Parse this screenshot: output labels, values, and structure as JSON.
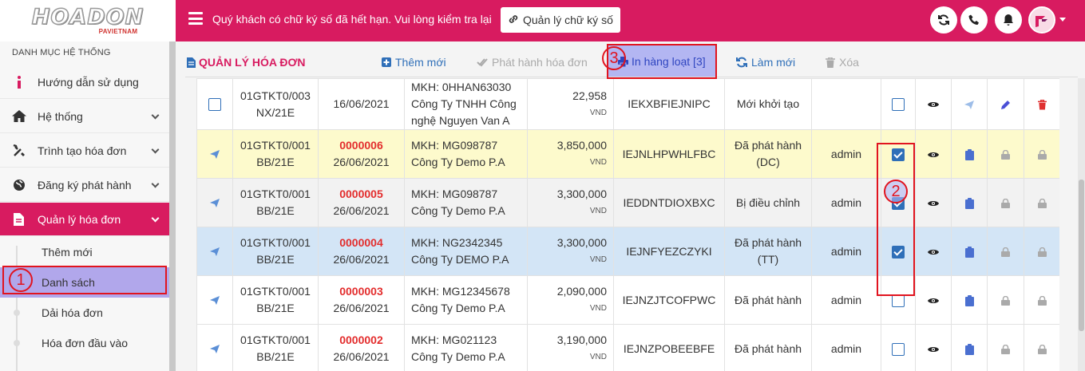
{
  "brand": {
    "logo_main": "HOADON",
    "logo_sub": "PAVIETNAM"
  },
  "header": {
    "notice": "Quý khách có chữ ký số đã hết hạn. Vui lòng kiểm tra lại",
    "sig_button": "Quản lý chữ ký số",
    "accent": "#d81b60"
  },
  "sidebar": {
    "heading": "DANH MỤC HỆ THỐNG",
    "items": [
      {
        "label": "Hướng dẫn sử dụng",
        "icon": "info-icon"
      },
      {
        "label": "Hệ thống",
        "icon": "home-icon"
      },
      {
        "label": "Trình tạo hóa đơn",
        "icon": "tools-icon"
      },
      {
        "label": "Đăng ký phát hành",
        "icon": "globe-icon"
      },
      {
        "label": "Quản lý hóa đơn",
        "icon": "document-icon"
      }
    ],
    "sub_items": [
      {
        "label": "Thêm mới"
      },
      {
        "label": "Danh sách"
      },
      {
        "label": "Dải hóa đơn"
      },
      {
        "label": "Hóa đơn đầu vào"
      }
    ]
  },
  "annotations": {
    "n1": "1",
    "n2": "2",
    "n3": "3"
  },
  "toolbar": {
    "title": "QUẢN LÝ HÓA ĐƠN",
    "add": "Thêm mới",
    "issue": "Phát hành hóa đơn",
    "print_batch": "In hàng loạt [3]",
    "refresh": "Làm mới",
    "delete": "Xóa"
  },
  "rows": [
    {
      "pattern": "01GTKT0/003",
      "series": "NX/21E",
      "number": "",
      "date": "16/06/2021",
      "cust1": "MKH: 0HHAN63030",
      "cust2": "Công Ty TNHH Công",
      "cust3": "nghệ Nguyen Van A",
      "amount": "22,958",
      "currency": "VND",
      "code": "IEKXBFIEJNIPC",
      "status1": "Mới khởi tạo",
      "status2": "",
      "user": "",
      "checked": false,
      "editable": true
    },
    {
      "pattern": "01GTKT0/001",
      "series": "BB/21E",
      "number": "0000006",
      "date": "26/06/2021",
      "cust1": "MKH: MG098787",
      "cust2": "Công Ty Demo P.A",
      "cust3": "",
      "amount": "3,850,000",
      "currency": "VND",
      "code": "IEJNLHPWHLFBC",
      "status1": "Đã phát hành",
      "status2": "(DC)",
      "user": "admin",
      "checked": true,
      "editable": false
    },
    {
      "pattern": "01GTKT0/001",
      "series": "BB/21E",
      "number": "0000005",
      "date": "26/06/2021",
      "cust1": "MKH: MG098787",
      "cust2": "Công Ty Demo P.A",
      "cust3": "",
      "amount": "3,300,000",
      "currency": "VND",
      "code": "IEDDNTDIOXBXC",
      "status1": "Bị điều chỉnh",
      "status2": "",
      "user": "admin",
      "checked": true,
      "editable": false
    },
    {
      "pattern": "01GTKT0/001",
      "series": "BB/21E",
      "number": "0000004",
      "date": "26/06/2021",
      "cust1": "MKH: NG2342345",
      "cust2": "Công Ty DEMO P.A",
      "cust3": "",
      "amount": "3,300,000",
      "currency": "VND",
      "code": "IEJNFYEZCZYKI",
      "status1": "Đã phát hành",
      "status2": "(TT)",
      "user": "admin",
      "checked": true,
      "editable": false
    },
    {
      "pattern": "01GTKT0/001",
      "series": "BB/21E",
      "number": "0000003",
      "date": "26/06/2021",
      "cust1": "MKH: MG12345678",
      "cust2": "Công Ty Demo P.A",
      "cust3": "",
      "amount": "2,090,000",
      "currency": "VND",
      "code": "IEJNZJTCOFPWC",
      "status1": "Đã phát hành",
      "status2": "",
      "user": "admin",
      "checked": false,
      "editable": false
    },
    {
      "pattern": "01GTKT0/001",
      "series": "BB/21E",
      "number": "0000002",
      "date": "26/06/2021",
      "cust1": "MKH: MG021123",
      "cust2": "Công Ty Demo P.A",
      "cust3": "",
      "amount": "3,190,000",
      "currency": "VND",
      "code": "IEJNZPOBEEBFE",
      "status1": "Đã phát hành",
      "status2": "",
      "user": "admin",
      "checked": false,
      "editable": false
    }
  ]
}
